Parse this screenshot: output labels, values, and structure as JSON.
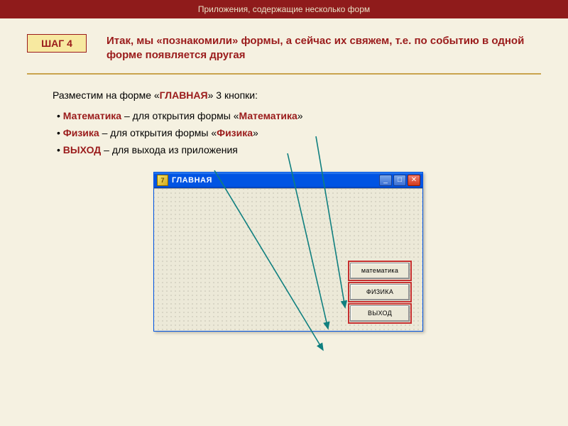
{
  "header": {
    "title": "Приложения, содержащие несколько форм"
  },
  "step": {
    "badge": "ШАГ 4",
    "text": "Итак, мы «познакомили» формы, а сейчас их свяжем, т.е. по событию в одной форме появляется другая"
  },
  "body": {
    "intro_prefix": "Разместим на форме «",
    "intro_kw": "ГЛАВНАЯ",
    "intro_suffix": "» 3 кнопки:",
    "items": [
      {
        "kw": "Математика",
        "mid": " – для открытия формы «",
        "kw2": "Математика",
        "end": "»"
      },
      {
        "kw": "Физика",
        "mid": " – для открытия формы «",
        "kw2": "Физика",
        "end": "»"
      },
      {
        "kw": "ВЫХОД",
        "mid": " – для выхода из приложения",
        "kw2": "",
        "end": ""
      }
    ]
  },
  "window": {
    "title": "ГЛАВНАЯ",
    "minimize": "_",
    "maximize": "□",
    "close": "✕",
    "buttons": [
      "математика",
      "ФИЗИКА",
      "ВЫХОД"
    ]
  }
}
